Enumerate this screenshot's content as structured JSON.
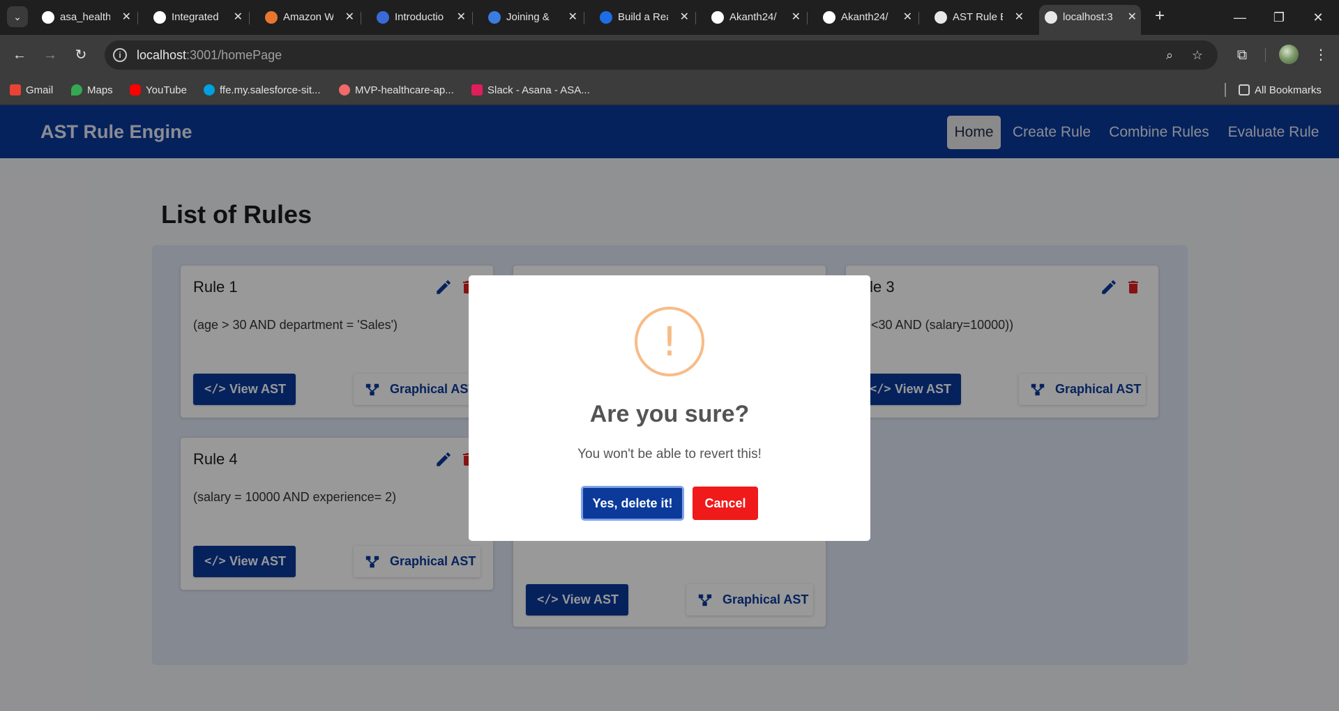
{
  "browser": {
    "tabs": [
      {
        "title": "asa_health",
        "favicon": "github-icon",
        "color": "#2a2a2a"
      },
      {
        "title": "Integrated",
        "favicon": "github-icon",
        "color": "#2a2a2a"
      },
      {
        "title": "Amazon W",
        "favicon": "aws-icon",
        "color": "#e8772e"
      },
      {
        "title": "Introductio",
        "favicon": "gear-logo-icon",
        "color": "#3a6ad8"
      },
      {
        "title": "Joining & ",
        "favicon": "bird-icon",
        "color": "#3a7de0"
      },
      {
        "title": "Build a Rea",
        "favicon": "bird-icon",
        "color": "#1e6de8"
      },
      {
        "title": "Akanth24/",
        "favicon": "github-icon",
        "color": "#2a2a2a"
      },
      {
        "title": "Akanth24/",
        "favicon": "github-icon",
        "color": "#2a2a2a"
      },
      {
        "title": "AST Rule E",
        "favicon": "openai-icon",
        "color": "#e8e8e8"
      },
      {
        "title": "localhost:3",
        "favicon": "triangle-icon",
        "color": "#e8e8e8"
      }
    ],
    "url_host": "localhost",
    "url_rest": ":3001/homePage",
    "bookmarks": [
      {
        "label": "Gmail",
        "color": "#ea4335"
      },
      {
        "label": "Maps",
        "color": "#34a853"
      },
      {
        "label": "YouTube",
        "color": "#ff0000"
      },
      {
        "label": "ffe.my.salesforce-sit...",
        "color": "#00a1e0"
      },
      {
        "label": "MVP-healthcare-ap...",
        "color": "#f06a6a"
      },
      {
        "label": "Slack - Asana - ASA...",
        "color": "#e01e5a"
      }
    ],
    "all_bookmarks": "All Bookmarks"
  },
  "app": {
    "brand": "AST Rule Engine",
    "nav": [
      "Home",
      "Create Rule",
      "Combine Rules",
      "Evaluate Rule"
    ],
    "active_nav": "Home",
    "page_title": "List of Rules",
    "rules": [
      {
        "name": "Rule 1",
        "expression": "(age > 30 AND department = 'Sales')"
      },
      {
        "name": "Rule 3",
        "expression": "age<30 AND (salary=10000))"
      },
      {
        "name": "Rule 4",
        "expression": "(salary = 10000 AND experience= 2)"
      }
    ],
    "view_ast_label": "View AST",
    "graph_ast_label": "Graphical AST",
    "colors": {
      "primary": "#0b3a9b",
      "danger": "#e02020",
      "panel": "#dde4f3"
    }
  },
  "modal": {
    "title": "Are you sure?",
    "text": "You won't be able to revert this!",
    "confirm_label": "Yes, delete it!",
    "cancel_label": "Cancel",
    "icon": "!"
  }
}
